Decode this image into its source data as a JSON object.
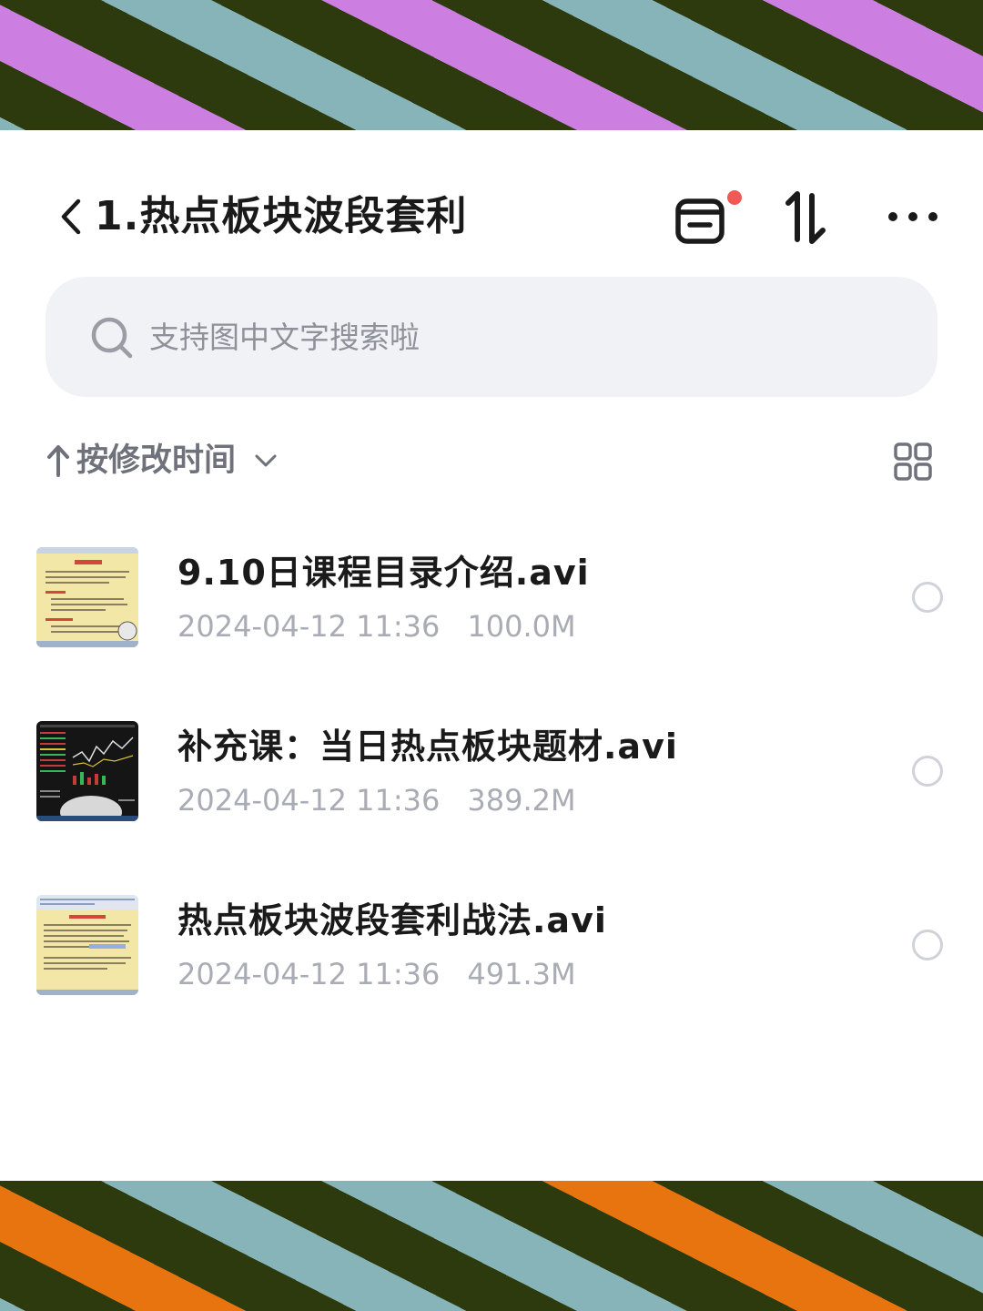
{
  "header": {
    "title": "1.热点板块波段套利"
  },
  "search": {
    "placeholder": "支持图中文字搜索啦"
  },
  "sort": {
    "arrow": "↑",
    "label": "按修改时间"
  },
  "icons": {
    "back": "chevron-left-icon",
    "box": "inbox-icon",
    "sort": "sort-arrows-icon",
    "more": "more-dots-icon",
    "search": "search-icon",
    "grid": "grid-view-icon",
    "notification_dot_color": "#f05a55"
  },
  "files": [
    {
      "name": "9.10日课程目录介绍.avi",
      "date": "2024-04-12 11:36",
      "size": "100.0M",
      "thumb": "document-thumbnail-yellow"
    },
    {
      "name": "补充课：当日热点板块题材.avi",
      "date": "2024-04-12 11:36",
      "size": "389.2M",
      "thumb": "stock-chart-thumbnail-dark"
    },
    {
      "name": "热点板块波段套利战法.avi",
      "date": "2024-04-12 11:36",
      "size": "491.3M",
      "thumb": "document-thumbnail-yellow"
    }
  ],
  "colors": {
    "stripe_dark": "#2d3a0d",
    "stripe_purple": "#cc7fe0",
    "stripe_teal": "#86b4b8",
    "stripe_orange": "#e8740f"
  }
}
